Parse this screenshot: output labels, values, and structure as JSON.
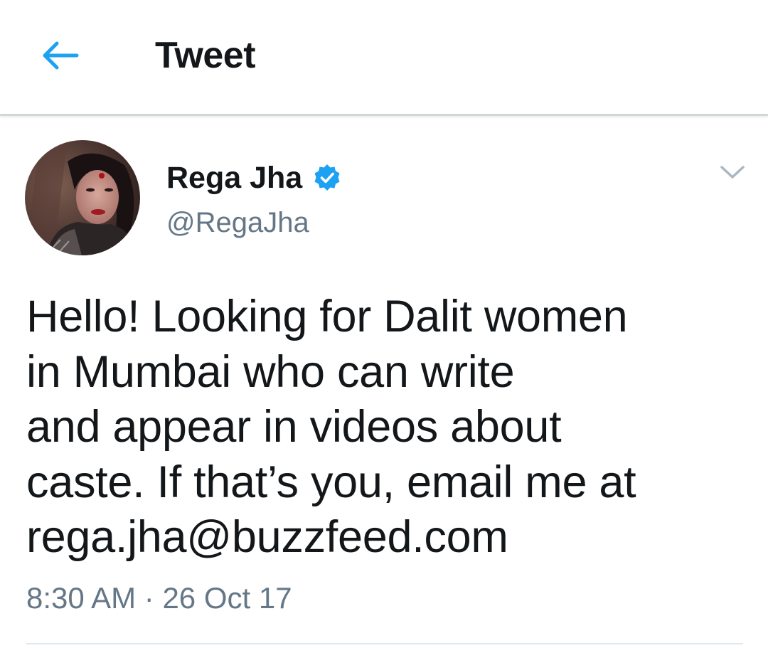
{
  "header": {
    "back_icon": "arrow-left-icon",
    "title": "Tweet",
    "accent_color": "#1da1f2"
  },
  "tweet": {
    "author": {
      "display_name": "Rega Jha",
      "handle": "@RegaJha",
      "verified": true,
      "verified_icon": "verified-badge-icon"
    },
    "menu_icon": "chevron-down-icon",
    "text": "Hello! Looking for Dalit women\nin Mumbai who can write\nand appear in videos about\ncaste. If that’s you, email me at\nrega.jha@buzzfeed.com",
    "time": "8:30 AM",
    "separator": "·",
    "date": "26 Oct 17"
  }
}
